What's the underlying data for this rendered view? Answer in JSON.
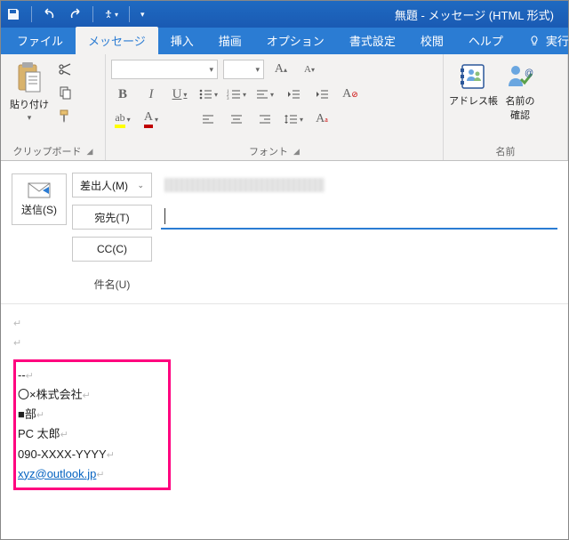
{
  "titlebar": {
    "title": "無題 - メッセージ (HTML 形式)"
  },
  "tabs": {
    "file": "ファイル",
    "message": "メッセージ",
    "insert": "挿入",
    "draw": "描画",
    "options": "オプション",
    "format": "書式設定",
    "review": "校閲",
    "help": "ヘルプ",
    "tell_me": "実行したい作"
  },
  "ribbon": {
    "clipboard": {
      "paste": "貼り付け",
      "label": "クリップボード"
    },
    "font": {
      "bold": "B",
      "italic": "I",
      "underline": "U",
      "highlight": "ab",
      "font_color": "A",
      "grow": "A",
      "shrink": "A",
      "clear_fmt": "A",
      "label": "フォント"
    },
    "names": {
      "address_book": "アドレス帳",
      "check_names": "名前の\n確認",
      "label": "名前"
    }
  },
  "header": {
    "send": "送信(S)",
    "from": "差出人(M)",
    "to": "宛先(T)",
    "cc": "CC(C)",
    "subject_label": "件名(U)",
    "subject_value": ""
  },
  "body": {
    "sig": {
      "sep": "--",
      "company": "〇×株式会社",
      "dept": "■部",
      "name": "PC 太郎",
      "phone": "090-XXXX-YYYY",
      "email": "xyz@outlook.jp"
    }
  }
}
